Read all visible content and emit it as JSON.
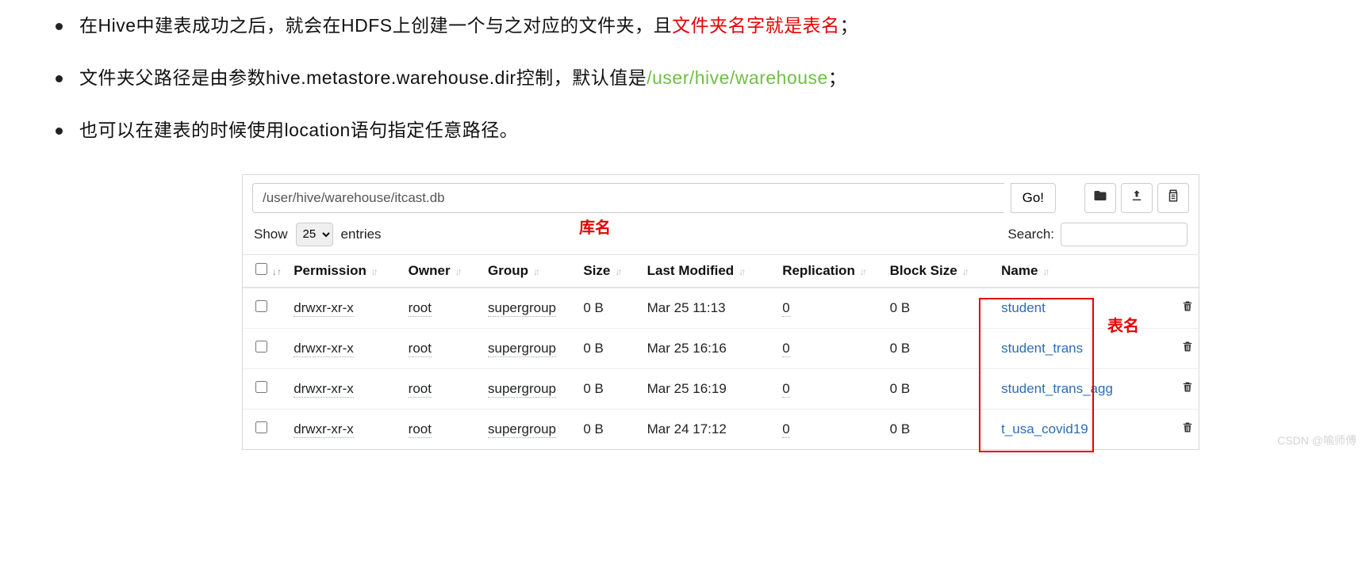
{
  "bullets": {
    "b1a": "在Hive中建表成功之后，就会在HDFS上创建一个与之对应的文件夹，且",
    "b1red": "文件夹名字就是表名",
    "b1b": "；",
    "b2a": "文件夹父路径是由参数hive.metastore.warehouse.dir控制，默认值是",
    "b2green": "/user/hive/warehouse",
    "b2b": "；",
    "b3": "也可以在建表的时候使用location语句指定任意路径。"
  },
  "toolbar": {
    "path": "/user/hive/warehouse/itcast.db",
    "go": "Go!"
  },
  "controls": {
    "show": "Show",
    "entries": "entries",
    "pagesize": "25",
    "search": "Search:"
  },
  "annot": {
    "ku": "库名",
    "biao": "表名"
  },
  "headers": {
    "perm": "Permission",
    "owner": "Owner",
    "group": "Group",
    "size": "Size",
    "mod": "Last Modified",
    "rep": "Replication",
    "blk": "Block Size",
    "name": "Name"
  },
  "rows": [
    {
      "perm": "drwxr-xr-x",
      "owner": "root",
      "group": "supergroup",
      "size": "0 B",
      "mod": "Mar 25 11:13",
      "rep": "0",
      "blk": "0 B",
      "name": "student"
    },
    {
      "perm": "drwxr-xr-x",
      "owner": "root",
      "group": "supergroup",
      "size": "0 B",
      "mod": "Mar 25 16:16",
      "rep": "0",
      "blk": "0 B",
      "name": "student_trans"
    },
    {
      "perm": "drwxr-xr-x",
      "owner": "root",
      "group": "supergroup",
      "size": "0 B",
      "mod": "Mar 25 16:19",
      "rep": "0",
      "blk": "0 B",
      "name": "student_trans_agg"
    },
    {
      "perm": "drwxr-xr-x",
      "owner": "root",
      "group": "supergroup",
      "size": "0 B",
      "mod": "Mar 24 17:12",
      "rep": "0",
      "blk": "0 B",
      "name": "t_usa_covid19"
    }
  ],
  "watermark": "CSDN @喻师傅"
}
